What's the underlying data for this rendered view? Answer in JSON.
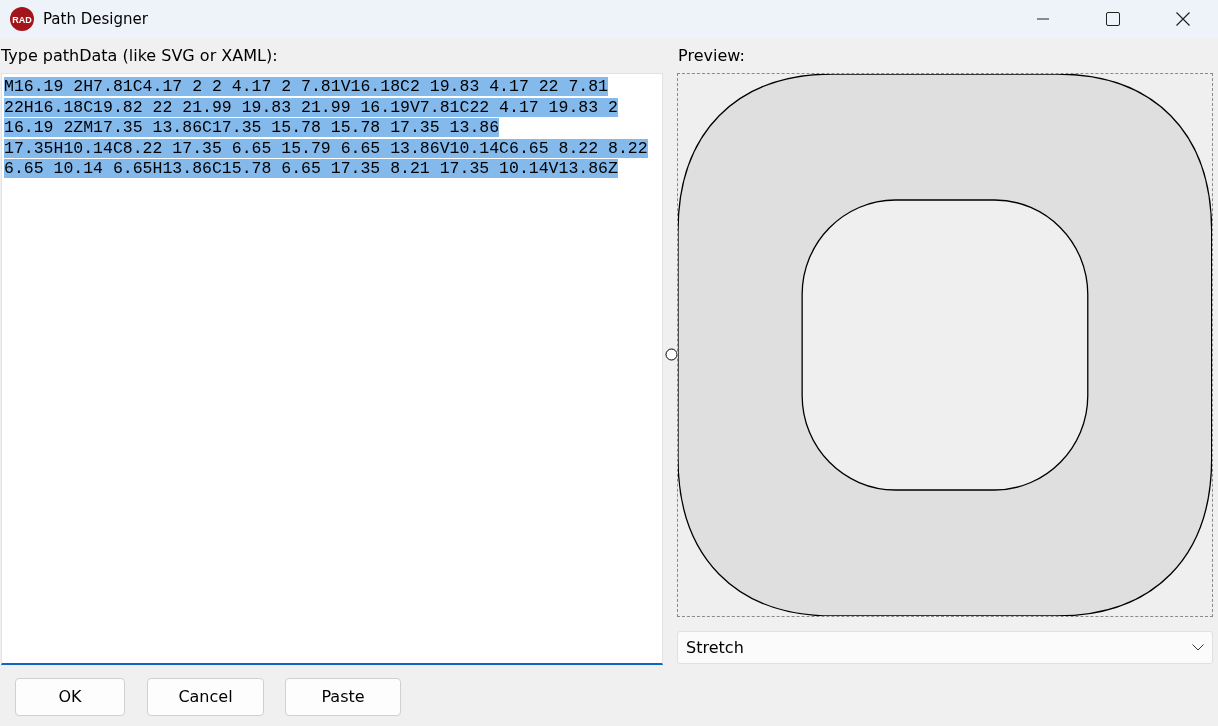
{
  "window": {
    "logo_text": "RAD",
    "title": "Path Designer"
  },
  "path_editor": {
    "label": "Type pathData (like SVG or XAML):",
    "value": "M16.19 2H7.81C4.17 2 2 4.17 2 7.81V16.18C2 19.83 4.17 22 7.81 22H16.18C19.82 22 21.99 19.83 21.99 16.19V7.81C22 4.17 19.83 2 16.19 2ZM17.35 13.86C17.35 15.78 15.78 17.35 13.86 17.35H10.14C8.22 17.35 6.65 15.79 6.65 13.86V10.14C6.65 8.22 8.22 6.65 10.14 6.65H13.86C15.78 6.65 17.35 8.21 17.35 10.14V13.86Z",
    "text_selected": true
  },
  "preview": {
    "label": "Preview:"
  },
  "stretch_dropdown": {
    "value": "Stretch"
  },
  "buttons": [
    "OK",
    "Cancel",
    "Paste"
  ]
}
